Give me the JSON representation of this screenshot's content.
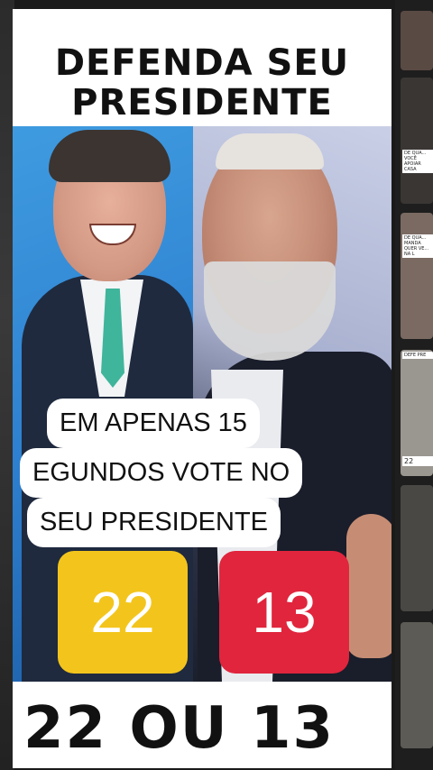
{
  "post": {
    "headline_line1": "DEFENDA SEU",
    "headline_line2": "PRESIDENTE",
    "caption_line1": "EM APENAS 15",
    "caption_line2": "EGUNDOS VOTE NO",
    "caption_line3": "SEU PRESIDENTE",
    "vote_option_1": "22",
    "vote_option_2": "13",
    "bottom_text": "22  OU  13",
    "colors": {
      "option_1": "#f3c51c",
      "option_2": "#e0253d",
      "card_background": "#ffffff"
    }
  },
  "sidebar": {
    "thumbnails": [
      {
        "caption": ""
      },
      {
        "caption": "DE QUA... VOCÊ APOIAR CASA"
      },
      {
        "caption": "DE QUA... MANDA QUER VE... NA L"
      },
      {
        "caption": "DEFE PRE"
      },
      {
        "caption": "22"
      },
      {
        "caption": ""
      },
      {
        "caption": ""
      }
    ]
  }
}
